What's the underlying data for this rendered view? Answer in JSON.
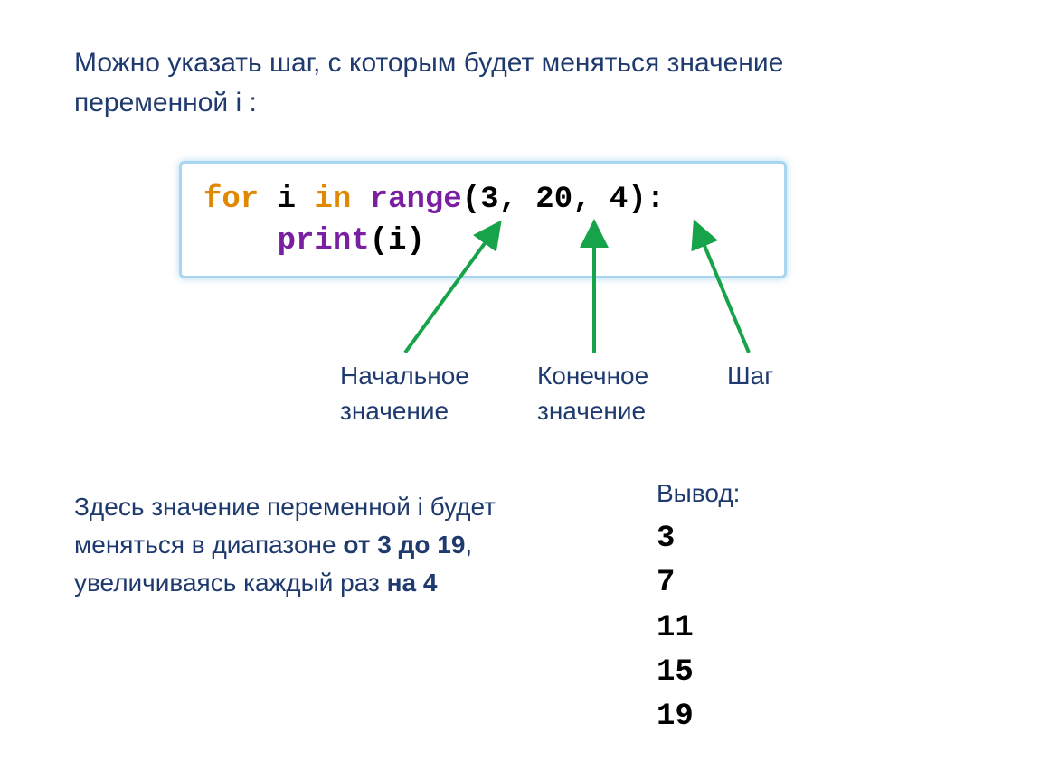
{
  "intro": "Можно указать шаг, с которым будет меняться значение переменной i :",
  "code": {
    "for": "for",
    "i": " i ",
    "in": "in",
    "sp": " ",
    "range": "range",
    "args": "(3, 20, 4):",
    "indent": "    ",
    "print": "print",
    "pargs": "(i)"
  },
  "labels": {
    "start": "Начальное\nзначение",
    "end": "Конечное\nзначение",
    "step": "Шаг"
  },
  "desc": {
    "p1": "Здесь значение переменной i будет меняться в диапазоне ",
    "b1": "от 3 до 19",
    "p2": ", увеличиваясь каждый раз ",
    "b2": "на 4"
  },
  "output": {
    "title": "Вывод:",
    "values": [
      "3",
      "7",
      "11",
      "15",
      "19"
    ]
  }
}
